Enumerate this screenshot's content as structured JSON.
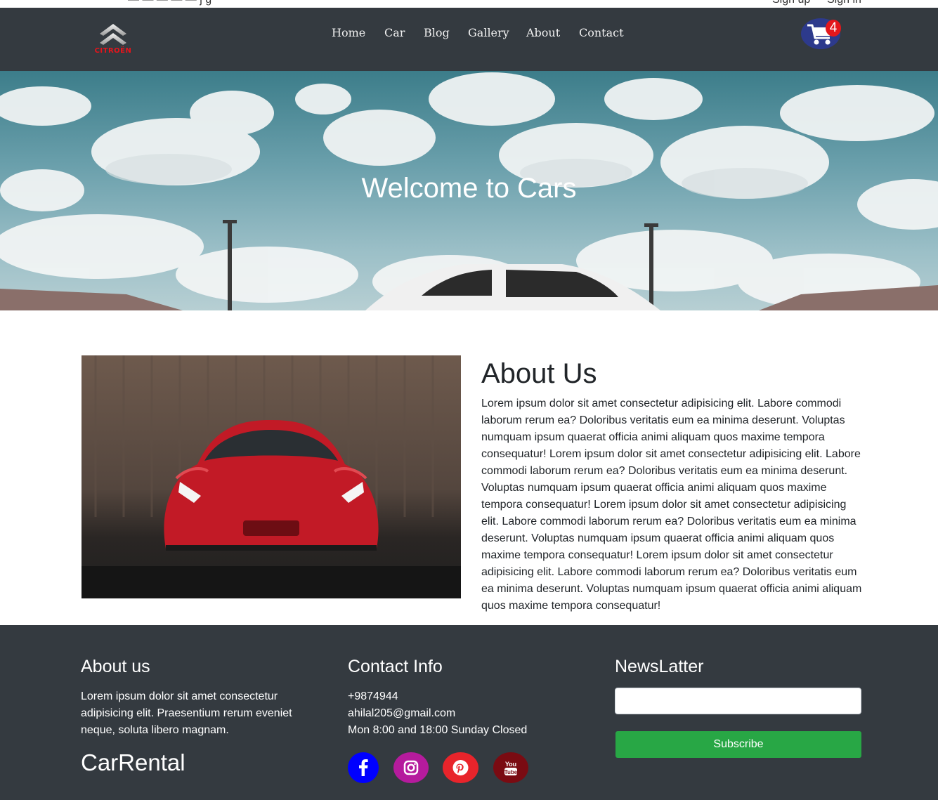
{
  "topbar": {
    "left_text": "— — — — —  j g",
    "signup_label": "Sign up",
    "signin_label": "Sign in"
  },
  "navbar": {
    "logo_text": "CITROËN",
    "items": [
      {
        "label": "Home"
      },
      {
        "label": "Car"
      },
      {
        "label": "Blog"
      },
      {
        "label": "Gallery"
      },
      {
        "label": "About"
      },
      {
        "label": "Contact"
      }
    ],
    "cart_icon": "shopping-cart-icon",
    "cart_count": "4"
  },
  "hero": {
    "title": "Welcome to Cars"
  },
  "about": {
    "title": "About Us",
    "text": "Lorem ipsum dolor sit amet consectetur adipisicing elit. Labore commodi laborum rerum ea? Doloribus veritatis eum ea minima deserunt. Voluptas numquam ipsum quaerat officia animi aliquam quos maxime tempora consequatur! Lorem ipsum dolor sit amet consectetur adipisicing elit. Labore commodi laborum rerum ea? Doloribus veritatis eum ea minima deserunt. Voluptas numquam ipsum quaerat officia animi aliquam quos maxime tempora consequatur! Lorem ipsum dolor sit amet consectetur adipisicing elit. Labore commodi laborum rerum ea? Doloribus veritatis eum ea minima deserunt. Voluptas numquam ipsum quaerat officia animi aliquam quos maxime tempora consequatur! Lorem ipsum dolor sit amet consectetur adipisicing elit. Labore commodi laborum rerum ea? Doloribus veritatis eum ea minima deserunt. Voluptas numquam ipsum quaerat officia animi aliquam quos maxime tempora consequatur!"
  },
  "footer": {
    "about_title": "About us",
    "about_text": "Lorem ipsum dolor sit amet consectetur adipisicing elit. Praesentium rerum eveniet neque, soluta libero magnam.",
    "brand": "CarRental",
    "contact_title": "Contact Info",
    "phone": "+9874944",
    "email": "ahilal205@gmail.com",
    "hours": "Mon 8:00 and 18:00 Sunday Closed",
    "newsletter_title": "NewsLatter",
    "newsletter_placeholder": "",
    "subscribe_label": "Subscribe",
    "social": [
      {
        "icon": "facebook-icon",
        "color": "#0000ff"
      },
      {
        "icon": "instagram-icon",
        "color": "#b51b9d"
      },
      {
        "icon": "pinterest-icon",
        "color": "#e8242b"
      },
      {
        "icon": "youtube-icon",
        "color": "#7a0b12"
      }
    ]
  },
  "colors": {
    "navbar_bg": "#343a40",
    "footer_bg": "#343a40",
    "subscribe_bg": "#28a745",
    "cart_bg": "#2d3a8c",
    "badge_bg": "#e4171b",
    "logo_red": "#e8141b"
  }
}
